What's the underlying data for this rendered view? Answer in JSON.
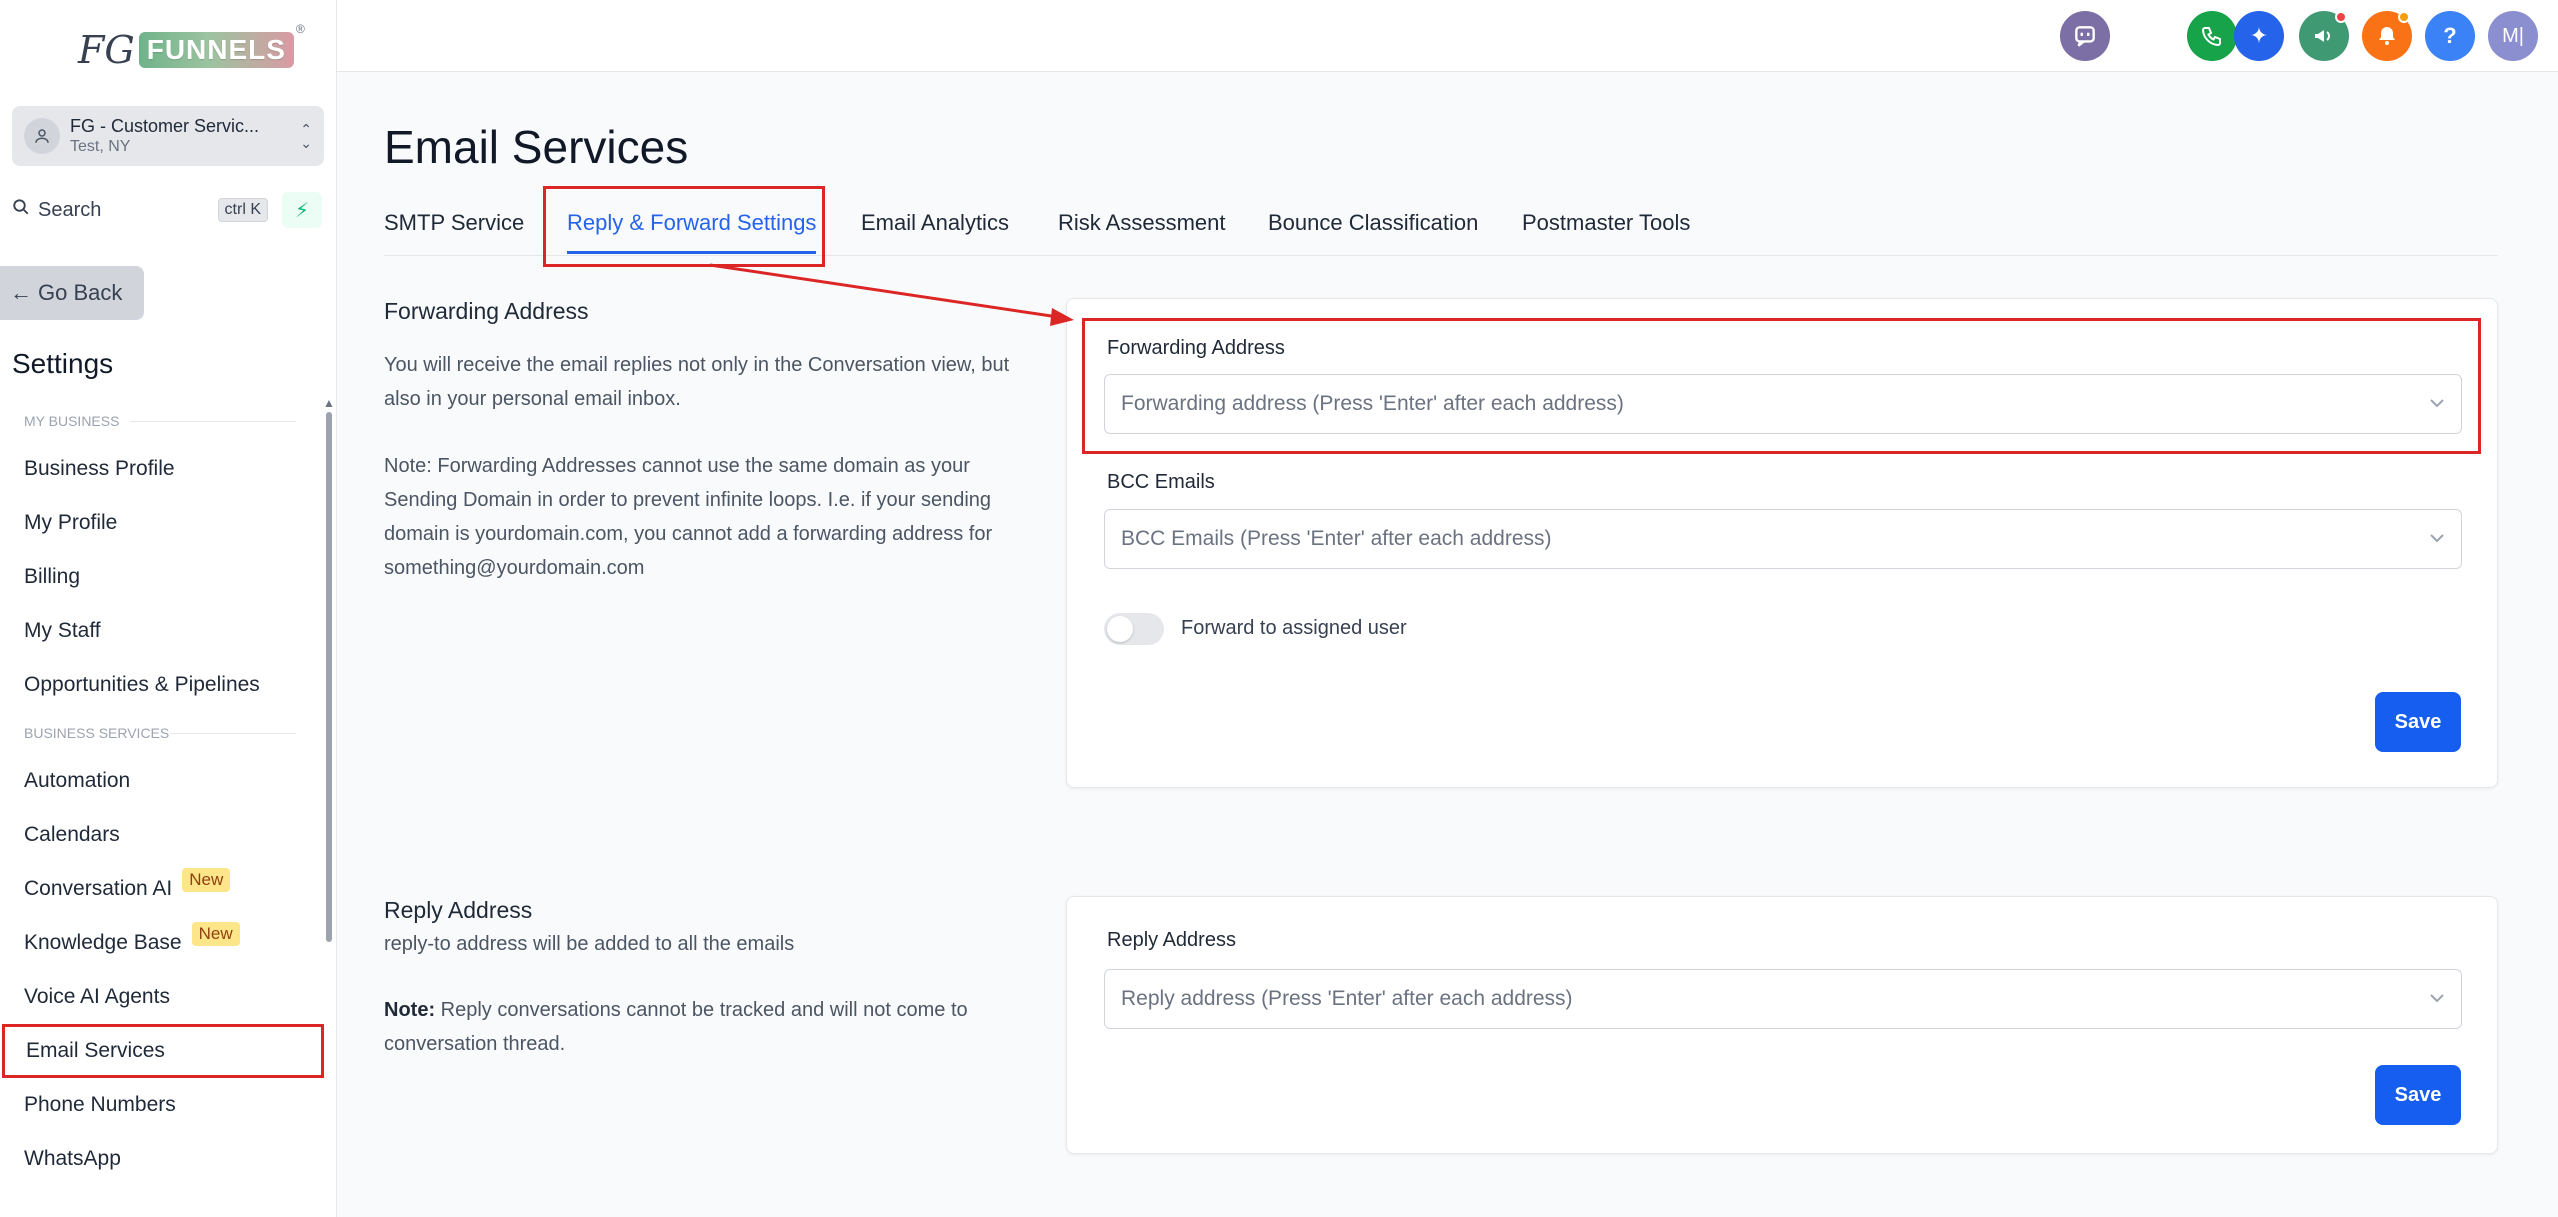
{
  "brand": {
    "logo_fg": "FG",
    "logo_word": "FUNNELS",
    "logo_reg": "®"
  },
  "account": {
    "name": "FG - Customer Servic...",
    "location": "Test, NY"
  },
  "search": {
    "label": "Search",
    "shortcut": "ctrl K"
  },
  "sidebar": {
    "go_back": "Go Back",
    "title": "Settings",
    "sections": [
      {
        "label": "MY BUSINESS"
      },
      {
        "label": "BUSINESS SERVICES"
      }
    ],
    "items": [
      {
        "label": "Business Profile"
      },
      {
        "label": "My Profile"
      },
      {
        "label": "Billing"
      },
      {
        "label": "My Staff"
      },
      {
        "label": "Opportunities & Pipelines"
      },
      {
        "label": "Automation"
      },
      {
        "label": "Calendars"
      },
      {
        "label": "Conversation AI",
        "badge": "New"
      },
      {
        "label": "Knowledge Base",
        "badge": "New"
      },
      {
        "label": "Voice AI Agents"
      },
      {
        "label": "Email Services",
        "active": true
      },
      {
        "label": "Phone Numbers"
      },
      {
        "label": "WhatsApp"
      }
    ]
  },
  "topbar": {
    "avatar_initials": "M|",
    "help": "?"
  },
  "page": {
    "title": "Email Services",
    "tabs": [
      {
        "label": "SMTP Service"
      },
      {
        "label": "Reply & Forward Settings",
        "active": true
      },
      {
        "label": "Email Analytics"
      },
      {
        "label": "Risk Assessment"
      },
      {
        "label": "Bounce Classification"
      },
      {
        "label": "Postmaster Tools"
      }
    ]
  },
  "forwarding": {
    "heading": "Forwarding Address",
    "desc": "You will receive the email replies not only in the Conversation view, but also in your personal email inbox.",
    "note": "Note: Forwarding Addresses cannot use the same domain as your Sending Domain in order to prevent infinite loops. I.e. if your sending domain is yourdomain.com, you cannot add a forwarding address for something@yourdomain.com",
    "field_label": "Forwarding Address",
    "field_placeholder": "Forwarding address (Press 'Enter' after each address)",
    "bcc_label": "BCC Emails",
    "bcc_placeholder": "BCC Emails (Press 'Enter' after each address)",
    "toggle_label": "Forward to assigned user",
    "toggle_on": false,
    "save": "Save"
  },
  "reply": {
    "heading": "Reply Address",
    "desc": "reply-to address will be added to all the emails",
    "note_bold": "Note:",
    "note": " Reply conversations cannot be tracked and will not come to conversation thread.",
    "field_label": "Reply Address",
    "field_placeholder": "Reply address (Press 'Enter' after each address)",
    "save": "Save"
  },
  "colors": {
    "accent": "#155eef",
    "highlight": "#dc2626"
  }
}
